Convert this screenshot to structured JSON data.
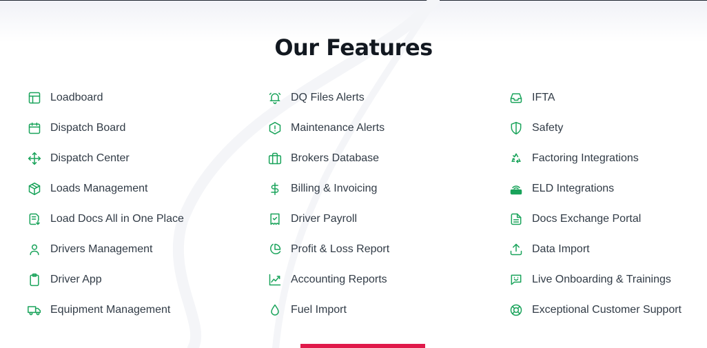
{
  "section": {
    "title": "Our Features"
  },
  "colors": {
    "accent": "#19a35a",
    "cta": "#e0194a",
    "title": "#121820"
  },
  "columns": [
    {
      "items": [
        {
          "label": "Loadboard",
          "icon": "layout-icon"
        },
        {
          "label": "Dispatch Board",
          "icon": "calendar-icon"
        },
        {
          "label": "Dispatch Center",
          "icon": "move-arrows-icon"
        },
        {
          "label": "Loads Management",
          "icon": "package-icon"
        },
        {
          "label": "Load Docs All in One Place",
          "icon": "file-download-icon"
        },
        {
          "label": "Drivers Management",
          "icon": "user-icon"
        },
        {
          "label": "Driver App",
          "icon": "clipboard-icon"
        },
        {
          "label": "Equipment Management",
          "icon": "truck-icon"
        }
      ]
    },
    {
      "items": [
        {
          "label": "DQ Files Alerts",
          "icon": "alarm-bell-icon"
        },
        {
          "label": "Maintenance Alerts",
          "icon": "hexagon-alert-icon"
        },
        {
          "label": "Brokers Database",
          "icon": "briefcase-icon"
        },
        {
          "label": "Billing & Invoicing",
          "icon": "dollar-icon"
        },
        {
          "label": "Driver Payroll",
          "icon": "receipt-check-icon"
        },
        {
          "label": "Profit & Loss Report",
          "icon": "pie-chart-icon"
        },
        {
          "label": "Accounting Reports",
          "icon": "trend-chart-icon"
        },
        {
          "label": "Fuel Import",
          "icon": "droplet-icon"
        }
      ]
    },
    {
      "items": [
        {
          "label": "IFTA",
          "icon": "inbox-icon"
        },
        {
          "label": "Safety",
          "icon": "shield-icon"
        },
        {
          "label": "Factoring Integrations",
          "icon": "recycle-icon"
        },
        {
          "label": "ELD Integrations",
          "icon": "router-icon"
        },
        {
          "label": "Docs Exchange Portal",
          "icon": "document-icon"
        },
        {
          "label": "Data Import",
          "icon": "upload-icon"
        },
        {
          "label": "Live Onboarding & Trainings",
          "icon": "chat-smile-icon"
        },
        {
          "label": "Exceptional Customer Support",
          "icon": "lifebuoy-icon"
        }
      ]
    }
  ]
}
